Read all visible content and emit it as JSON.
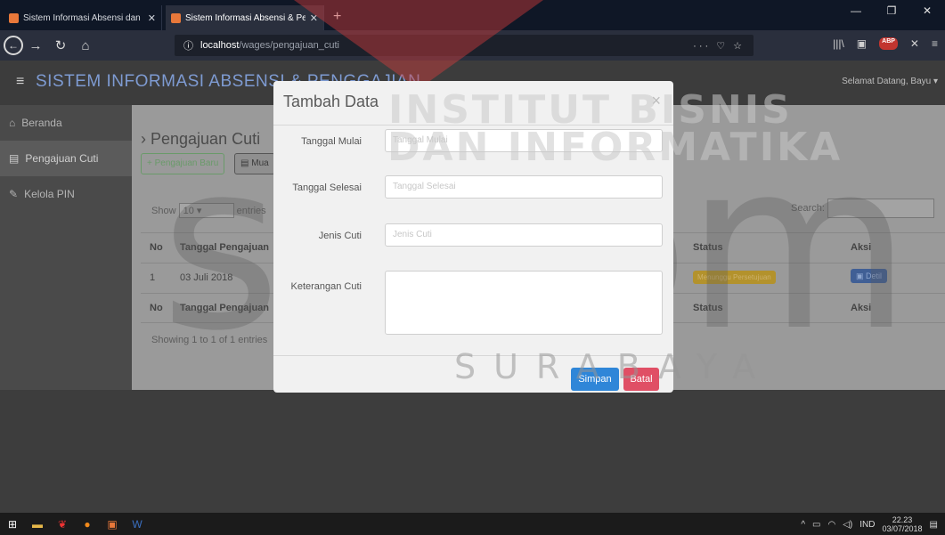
{
  "browser": {
    "tabs": [
      {
        "title": "Sistem Informasi Absensi dan P"
      },
      {
        "title": "Sistem Informasi Absensi & Pe"
      }
    ],
    "new_tab": "+",
    "url_host": "localhost",
    "url_path": "/wages/pengajuan_cuti",
    "url_icons": "··· ♡ ☆"
  },
  "app": {
    "title": "SISTEM INFORMASI ABSENSI & PENGGAJIAN",
    "user_greeting": "Selamat Datang, Bayu ▾",
    "sidebar": [
      {
        "label": "Beranda",
        "icon": "home-icon"
      },
      {
        "label": "Pengajuan Cuti",
        "icon": "document-icon"
      },
      {
        "label": "Kelola PIN",
        "icon": "edit-icon"
      }
    ],
    "page_title": "› Pengajuan Cuti",
    "add_button": "+ Pengajuan Baru",
    "load_button": "Mua",
    "show_label": "Show",
    "show_value": "10",
    "entries_label": "entries",
    "search_label": "Search:",
    "table": {
      "headers": [
        "No",
        "Tanggal Pengajuan",
        "Status",
        "Aksi"
      ],
      "rows": [
        {
          "no": "1",
          "tanggal": "03 Juli 2018",
          "status": "Menunggu Persetujuan",
          "aksi": "Detil"
        }
      ]
    },
    "info": "Showing 1 to 1 of 1 entries"
  },
  "modal": {
    "title": "Tambah Data",
    "close": "×",
    "fields": [
      {
        "label": "Tanggal Mulai",
        "placeholder": "Tanggal Mulai"
      },
      {
        "label": "Tanggal Selesai",
        "placeholder": "Tanggal Selesai"
      },
      {
        "label": "Jenis Cuti",
        "placeholder": "Jenis Cuti"
      },
      {
        "label": "Keterangan Cuti",
        "placeholder": ""
      }
    ],
    "save_label": "Simpan",
    "cancel_label": "Batal",
    "colors": {
      "save": "#2f86d8",
      "cancel": "#e04f65"
    }
  },
  "watermark": {
    "line1": "INSTITUT BISNIS",
    "line2": "DAN INFORMATIKA",
    "logo": "stikom",
    "city": "SURABAYA"
  },
  "taskbar": {
    "lang": "IND",
    "time": "22.23",
    "date": "03/07/2018"
  }
}
